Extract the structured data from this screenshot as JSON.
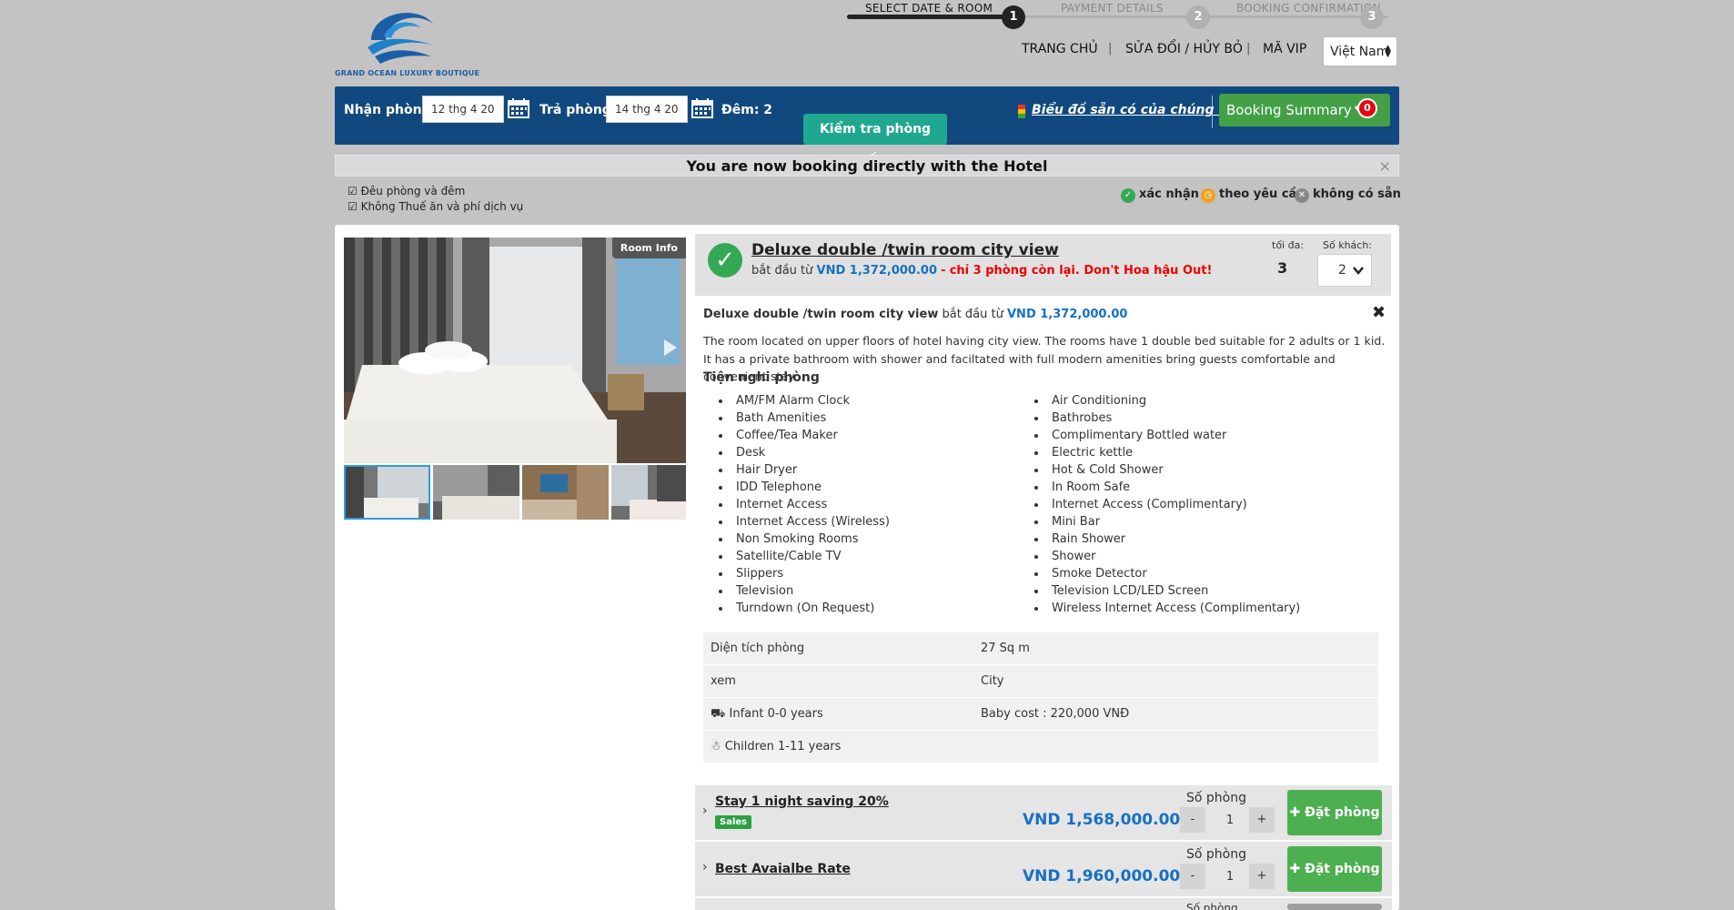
{
  "logo": {
    "text": "GRAND OCEAN LUXURY BOUTIQUE"
  },
  "steps": [
    {
      "label": "SELECT DATE & ROOM",
      "number": "1"
    },
    {
      "label": "PAYMENT DETAILS",
      "number": "2"
    },
    {
      "label": "BOOKING CONFIRMATION",
      "number": "3"
    }
  ],
  "nav": {
    "home": "TRANG CHỦ",
    "modify": "SỬA ĐỔI / HỦY BỎ",
    "vip": "MÃ VIP",
    "sep": "|",
    "language": "Việt Nam"
  },
  "search": {
    "checkin_label": "Nhận phòng:",
    "checkin_value": "12 thg 4 20",
    "checkout_label": "Trả phòng:",
    "checkout_value": "14 thg 4 20",
    "nights": "Đêm: 2",
    "check_button": "Kiểm tra phòng trống",
    "map_link": "Biểu đồ sẵn có của chúng tôi",
    "summary_button": "Booking Summary",
    "summary_count": "0"
  },
  "direct_banner": "You are now booking directly with the Hotel",
  "notes": [
    "Đêu phòng và đêm",
    "Không Thuế ăn và phí dịch vụ"
  ],
  "legend": {
    "confirmed": "xác nhận",
    "on_request": "theo yêu cầu",
    "unavailable": "không có sẵn"
  },
  "room": {
    "room_info_label": "Room Info",
    "name": "Deluxe double /twin room city view",
    "from_label": "bắt đầu từ",
    "from_price": "VND 1,372,000.00",
    "dash": "-",
    "left_text": "chỉ 3 phòng còn lại. Don't Hoa hậu Out!",
    "max_label": "tối đa:",
    "max_value": "3",
    "guests_label": "Số khách:",
    "guests_value": "2",
    "description": "The room located on upper floors of hotel having city view. The rooms have 1 double bed suitable for 2 adults or 1 kid. It has a private bathroom with shower and faciltated with full modern amenities bring guests comfortable and convenient stay.",
    "amenities_title": "Tiện nghi phòng",
    "amenities_left": [
      "AM/FM Alarm Clock",
      "Bath Amenities",
      "Coffee/Tea Maker",
      "Desk",
      "Hair Dryer",
      "IDD Telephone",
      "Internet Access",
      "Internet Access (Wireless)",
      "Non Smoking Rooms",
      "Satellite/Cable TV",
      "Slippers",
      "Television",
      "Turndown (On Request)"
    ],
    "amenities_right": [
      "Air Conditioning",
      "Bathrobes",
      "Complimentary Bottled water",
      "Electric kettle",
      "Hot & Cold Shower",
      "In Room Safe",
      "Internet Access (Complimentary)",
      "Mini Bar",
      "Rain Shower",
      "Shower",
      "Smoke Detector",
      "Television LCD/LED Screen",
      "Wireless Internet Access (Complimentary)"
    ],
    "specs": [
      {
        "key": "Diện tích phòng",
        "value": "27 Sq m"
      },
      {
        "key": "xem",
        "value": "City"
      },
      {
        "key": "Infant 0-0 years",
        "value": "Baby cost : 220,000 VNĐ"
      },
      {
        "key": "Children 1-11 years",
        "value": ""
      }
    ]
  },
  "rates": [
    {
      "name": "Stay 1 night saving 20%",
      "tag": "Sales",
      "price": "VND 1,568,000.00",
      "qty_label": "Số phòng",
      "qty": "1",
      "minus": "-",
      "plus": "+",
      "book": "Đặt phòng"
    },
    {
      "name": "Best Avaialbe Rate",
      "tag": "",
      "price": "VND 1,960,000.00",
      "qty_label": "Số phòng",
      "qty": "1",
      "minus": "-",
      "plus": "+",
      "book": "Đặt phòng"
    },
    {
      "name": "",
      "tag": "",
      "price": "",
      "qty_label": "Số phòng",
      "qty": "",
      "minus": "",
      "plus": "",
      "book": ""
    }
  ],
  "colors": {
    "bar": "#11497e",
    "teal": "#1fa88f",
    "green": "#43a047",
    "price_blue": "#1770c2",
    "red": "#e00000"
  }
}
